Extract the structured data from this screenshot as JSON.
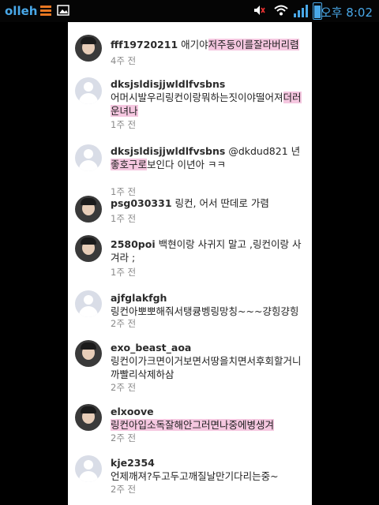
{
  "status_bar": {
    "carrier": "olleh",
    "time": "오후 8:02"
  },
  "comments": [
    {
      "username": "fff19720211",
      "text_pre": " 애기야",
      "text_hl": "저주둥이를잘라버리렴",
      "text_post": "",
      "time": "4주 전",
      "avatar": "photo"
    },
    {
      "username": "dksjsldisjjwldlfvsbns",
      "text_pre": "어머시발우리링컨이랑뭐하는짓이야떨어져",
      "text_hl": "더러운녀나",
      "text_post": "",
      "time": "1주 전",
      "avatar": "blank"
    },
    {
      "username": "dksjsldisjjwldlfvsbns",
      "text_pre": " @dkdud821 년",
      "text_hl": "좋호구로",
      "text_post": "보인다 이년아 ㅋㅋ",
      "time": "1주 전",
      "avatar": "blank"
    },
    {
      "username": "psg030331",
      "text_pre": " 링컨, 어서 딴데로 가렴",
      "text_hl": "",
      "text_post": "",
      "time": "1주 전",
      "avatar": "photo"
    },
    {
      "username": "2580poi",
      "text_pre": " 백현이랑 사귀지 말고 ,링컨이랑 사겨라 ;",
      "text_hl": "",
      "text_post": "",
      "time": "1주 전",
      "avatar": "photo"
    },
    {
      "username": "ajfglakfgh",
      "text_pre": "링컨아뽀뽀해줘서탱큥벵링망칭~~~걍힝걍힝",
      "text_hl": "",
      "text_post": "",
      "time": "2주 전",
      "avatar": "blank"
    },
    {
      "username": "exo_beast_aoa",
      "text_pre": "링컨이가크면이거보면서땅을치면서후회할거니까빨리삭제하삼",
      "text_hl": "",
      "text_post": "",
      "time": "2주 전",
      "avatar": "photo"
    },
    {
      "username": "elxoove",
      "text_pre": "",
      "text_hl": "링컨아입소독잘해안그러면나중에병생겨",
      "text_post": "",
      "time": "2주 전",
      "avatar": "photo"
    },
    {
      "username": "kje2354",
      "text_pre": "언제깨져?두고두고깨질날만기다리는중~",
      "text_hl": "",
      "text_post": "",
      "time": "2주 전",
      "avatar": "blank"
    }
  ]
}
